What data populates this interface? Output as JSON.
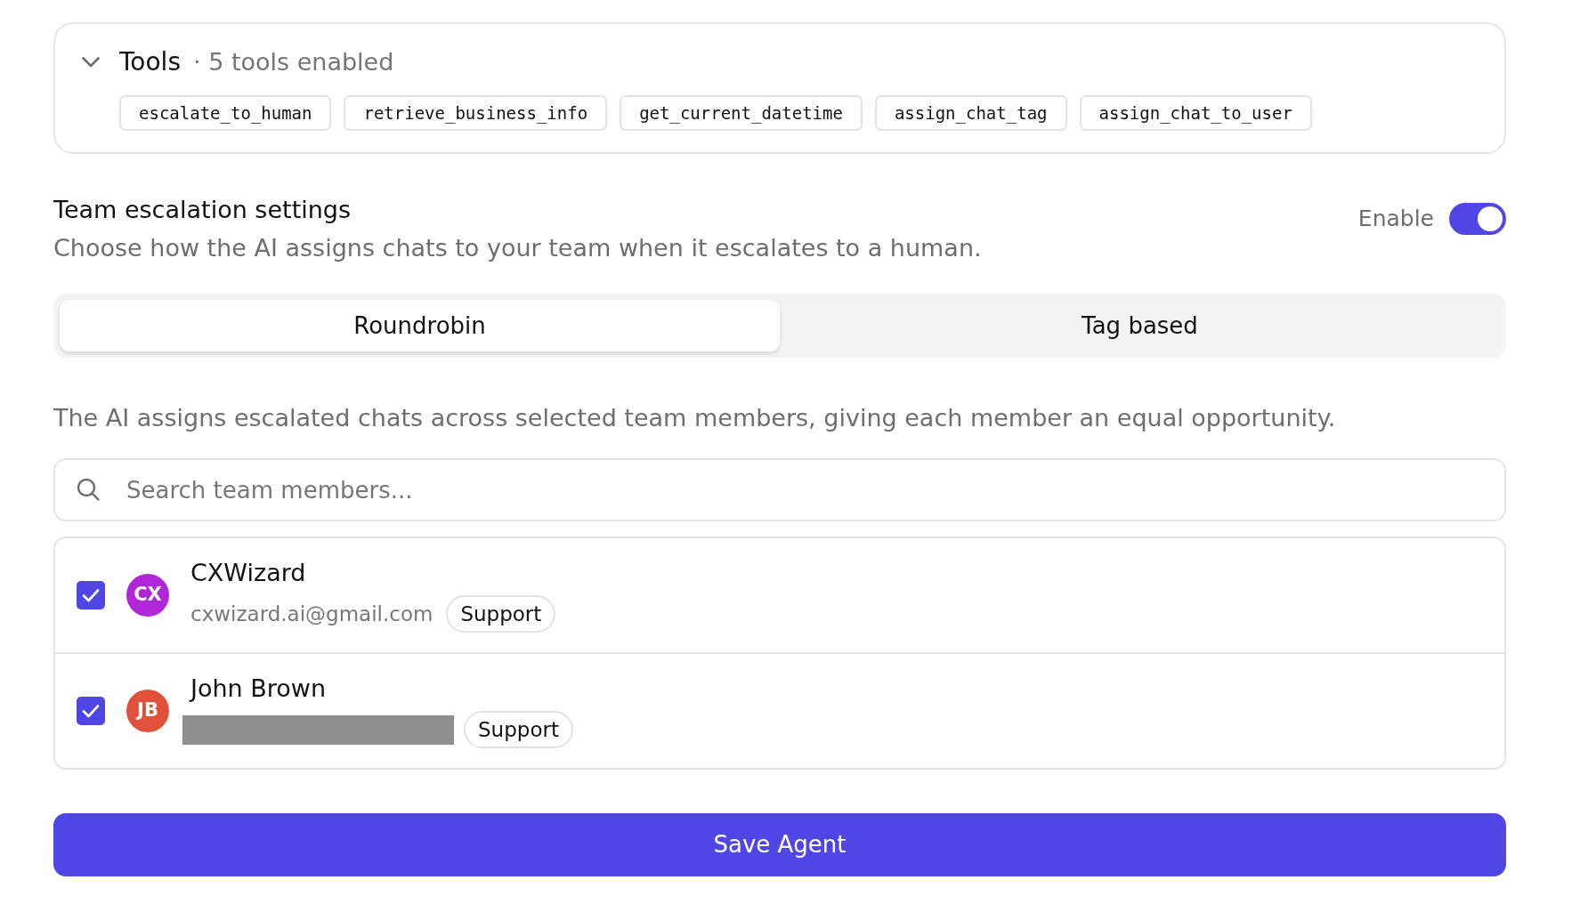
{
  "tools": {
    "title": "Tools",
    "summary": "· 5 tools enabled",
    "expanded": true,
    "items": [
      "escalate_to_human",
      "retrieve_business_info",
      "get_current_datetime",
      "assign_chat_tag",
      "assign_chat_to_user"
    ]
  },
  "escalation": {
    "title": "Team escalation settings",
    "subtitle": "Choose how the AI assigns chats to your team when it escalates to a human.",
    "toggle_label": "Enable",
    "enabled": true
  },
  "modes": [
    {
      "label": "Roundrobin",
      "selected": true
    },
    {
      "label": "Tag based",
      "selected": false
    }
  ],
  "mode_description": "The AI assigns escalated chats across selected team members, giving each member an equal opportunity.",
  "search": {
    "placeholder": "Search team members..."
  },
  "members": [
    {
      "initials": "CX",
      "name": "CXWizard",
      "email": "cxwizard.ai@gmail.com",
      "redacted": false,
      "tag": "Support",
      "checked": true,
      "color": "#b026d9"
    },
    {
      "initials": "JB",
      "name": "John Brown",
      "redacted": true,
      "tag": "Support",
      "checked": true,
      "color": "#e0503a"
    }
  ],
  "save_button": "Save Agent"
}
